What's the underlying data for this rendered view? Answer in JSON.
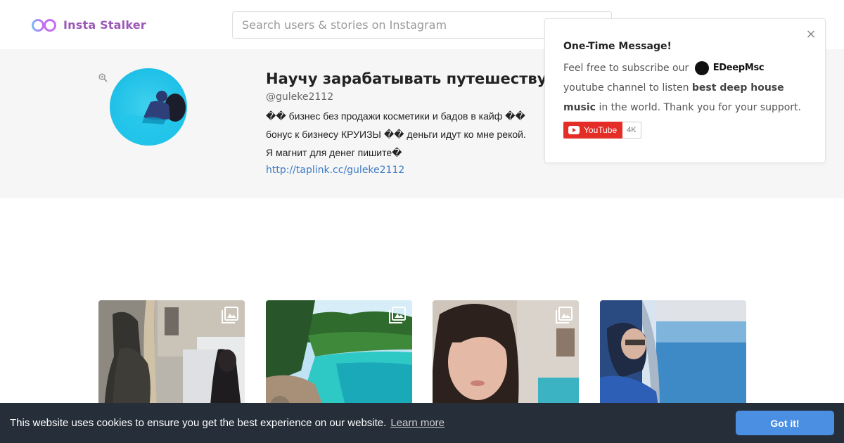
{
  "header": {
    "logo_text": "Insta Stalker",
    "search_placeholder": "Search users & stories on Instagram"
  },
  "profile": {
    "name": "Научу зарабатывать путешествуя",
    "handle": "@guleke2112",
    "bio": "�� бизнес без продажи косметики и бадов в кайф �� бонус к бизнесу КРУИЗЫ �� деньги идут ко мне рекой. Я магнит для денег пишите�",
    "link": "http://taplink.cc/guleke2112"
  },
  "popup": {
    "title": "One-Time Message!",
    "text_before_brand": "Feel free to subscribe our",
    "brand_name": "EDeepMsc",
    "text_after_brand": "youtube channel to listen",
    "highlight": "best deep house music",
    "text_end": "in the world. Thank you for your support.",
    "close_symbol": "×",
    "youtube_label": "YouTube",
    "youtube_count": "4K"
  },
  "posts": [
    {
      "name": "post-statue-street",
      "has_gallery": true
    },
    {
      "name": "post-beach",
      "has_gallery": true
    },
    {
      "name": "post-woman-portrait",
      "has_gallery": true
    },
    {
      "name": "post-cruise-window",
      "has_gallery": false
    }
  ],
  "cookie": {
    "message": "This website uses cookies to ensure you get the best experience on our website.",
    "learn_more": "Learn more",
    "accept": "Got it!"
  },
  "colors": {
    "brand": "#9b59b6",
    "cookie_bg": "#252e39",
    "cookie_button": "#4b8fe2",
    "youtube_red": "#e52d27",
    "link": "#3b7bc7"
  }
}
